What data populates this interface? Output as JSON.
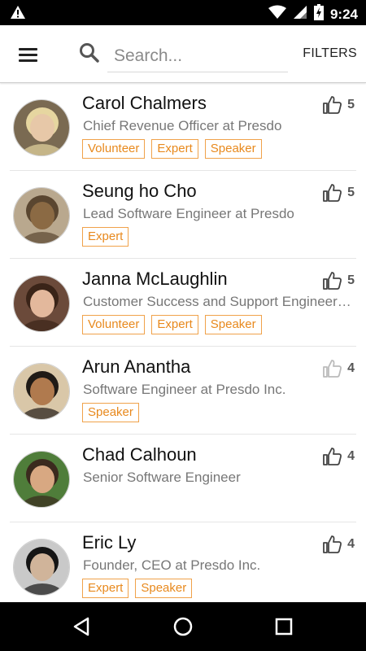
{
  "status_bar": {
    "time": "9:24",
    "notification_icon": "warning-icon",
    "icons": [
      "wifi-icon",
      "cellular-icon",
      "battery-charging-icon"
    ]
  },
  "app_bar": {
    "menu_icon": "hamburger-menu-icon",
    "search_icon": "search-icon",
    "search_placeholder": "Search...",
    "search_value": "",
    "filters_label": "FILTERS"
  },
  "people": [
    {
      "name": "Carol Chalmers",
      "title": "Chief Revenue Officer at Presdo",
      "tags": [
        "Volunteer",
        "Expert",
        "Speaker"
      ],
      "likes": "5",
      "liked": true
    },
    {
      "name": "Seung ho Cho",
      "title": "Lead Software Engineer at Presdo",
      "tags": [
        "Expert"
      ],
      "likes": "5",
      "liked": true
    },
    {
      "name": "Janna McLaughlin",
      "title": "Customer Success and Support Engineer at Presdo",
      "tags": [
        "Volunteer",
        "Expert",
        "Speaker"
      ],
      "likes": "5",
      "liked": true
    },
    {
      "name": "Arun Anantha",
      "title": "Software Engineer at Presdo Inc.",
      "tags": [
        "Speaker"
      ],
      "likes": "4",
      "liked": false
    },
    {
      "name": "Chad Calhoun",
      "title": "Senior Software Engineer",
      "tags": [],
      "likes": "4",
      "liked": true
    },
    {
      "name": "Eric Ly",
      "title": "Founder, CEO at Presdo Inc.",
      "tags": [
        "Expert",
        "Speaker"
      ],
      "likes": "4",
      "liked": true
    }
  ],
  "nav_bar": {
    "icons": [
      "back-icon",
      "home-icon",
      "recents-icon"
    ]
  },
  "colors": {
    "tag_accent": "#e8891d",
    "liked_icon": "#444444",
    "unliked_icon": "#bbbbbb"
  }
}
